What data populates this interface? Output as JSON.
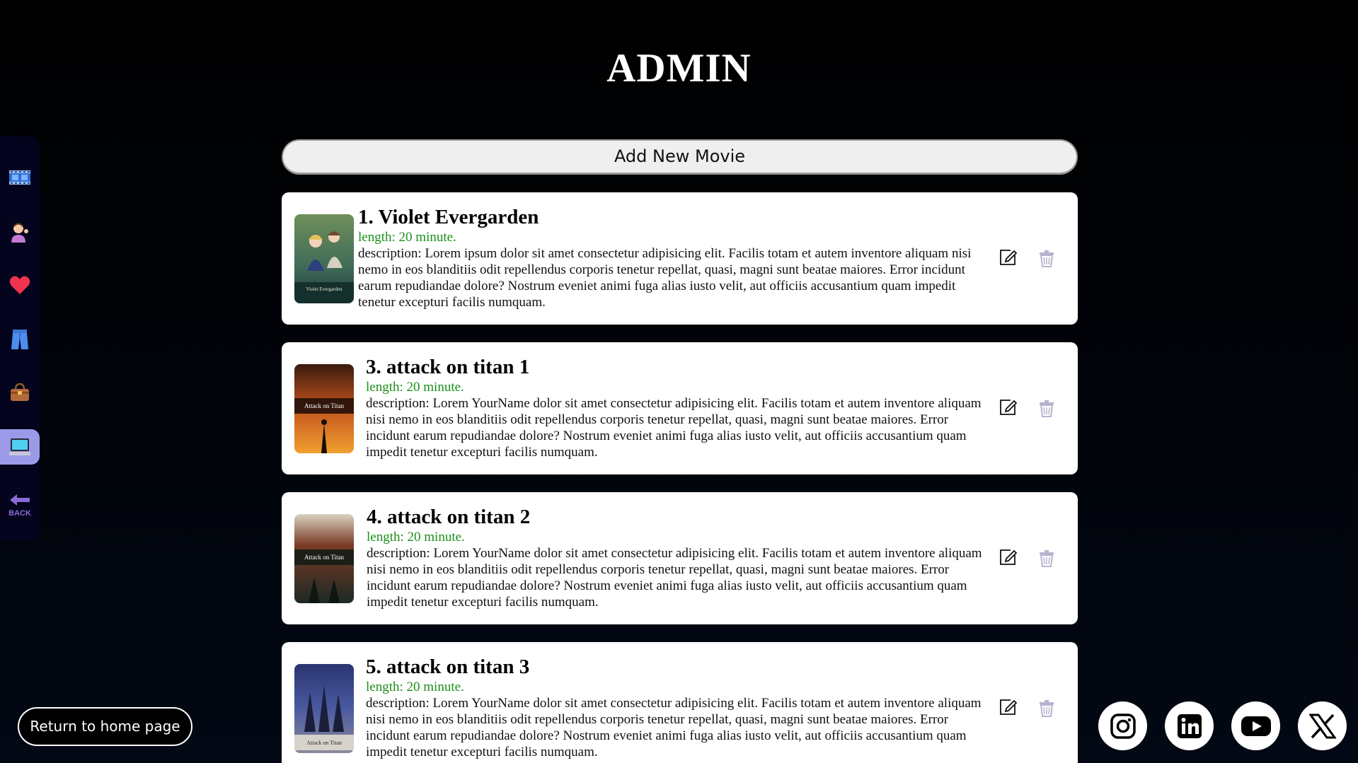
{
  "page": {
    "title": "ADMIN"
  },
  "sidebar": {
    "items": [
      {
        "icon": "film-icon"
      },
      {
        "icon": "person-tipping-hand-icon"
      },
      {
        "icon": "heart-icon"
      },
      {
        "icon": "jeans-icon"
      },
      {
        "icon": "handbag-icon"
      },
      {
        "icon": "computer-icon",
        "active": true
      }
    ],
    "back_label": "BACK"
  },
  "add_button": {
    "label": "Add New Movie"
  },
  "movies": [
    {
      "title": "1. Violet Evergarden",
      "length": "length: 20 minute.",
      "description": "description: Lorem ipsum dolor sit amet consectetur adipisicing elit. Facilis totam et autem inventore aliquam nisi nemo in eos blanditiis odit repellendus corporis tenetur repellat, quasi, magni sunt beatae maiores. Error incidunt earum repudiandae dolore? Nostrum eveniet animi fuga alias iusto velit, aut officiis accusantium quam impedit tenetur excepturi facilis numquam."
    },
    {
      "title": "3. attack on titan 1",
      "length": "length: 20 minute.",
      "description": "description: Lorem YourName dolor sit amet consectetur adipisicing elit. Facilis totam et autem inventore aliquam nisi nemo in eos blanditiis odit repellendus corporis tenetur repellat, quasi, magni sunt beatae maiores. Error incidunt earum repudiandae dolore? Nostrum eveniet animi fuga alias iusto velit, aut officiis accusantium quam impedit tenetur excepturi facilis numquam."
    },
    {
      "title": "4. attack on titan 2",
      "length": "length: 20 minute.",
      "description": "description: Lorem YourName dolor sit amet consectetur adipisicing elit. Facilis totam et autem inventore aliquam nisi nemo in eos blanditiis odit repellendus corporis tenetur repellat, quasi, magni sunt beatae maiores. Error incidunt earum repudiandae dolore? Nostrum eveniet animi fuga alias iusto velit, aut officiis accusantium quam impedit tenetur excepturi facilis numquam."
    },
    {
      "title": "5. attack on titan 3",
      "length": "length: 20 minute.",
      "description": "description: Lorem YourName dolor sit amet consectetur adipisicing elit. Facilis totam et autem inventore aliquam nisi nemo in eos blanditiis odit repellendus corporis tenetur repellat, quasi, magni sunt beatae maiores. Error incidunt earum repudiandae dolore? Nostrum eveniet animi fuga alias iusto velit, aut officiis accusantium quam impedit tenetur excepturi facilis numquam."
    }
  ],
  "poster_art": [
    {
      "caption": "Violet Evergarden"
    },
    {
      "caption": "Attack on Titan"
    },
    {
      "caption": "Attack on Titan"
    },
    {
      "caption": "Attack on Titan"
    }
  ],
  "footer": {
    "return_label": "Return to home page",
    "social": [
      "instagram-icon",
      "linkedin-icon",
      "youtube-icon",
      "x-icon"
    ]
  },
  "colors": {
    "background": "#000000",
    "sidebar": "#04041e",
    "sidebar_active": "#9c9ae8",
    "length_text": "#1a8f1a",
    "card": "#ffffff"
  }
}
